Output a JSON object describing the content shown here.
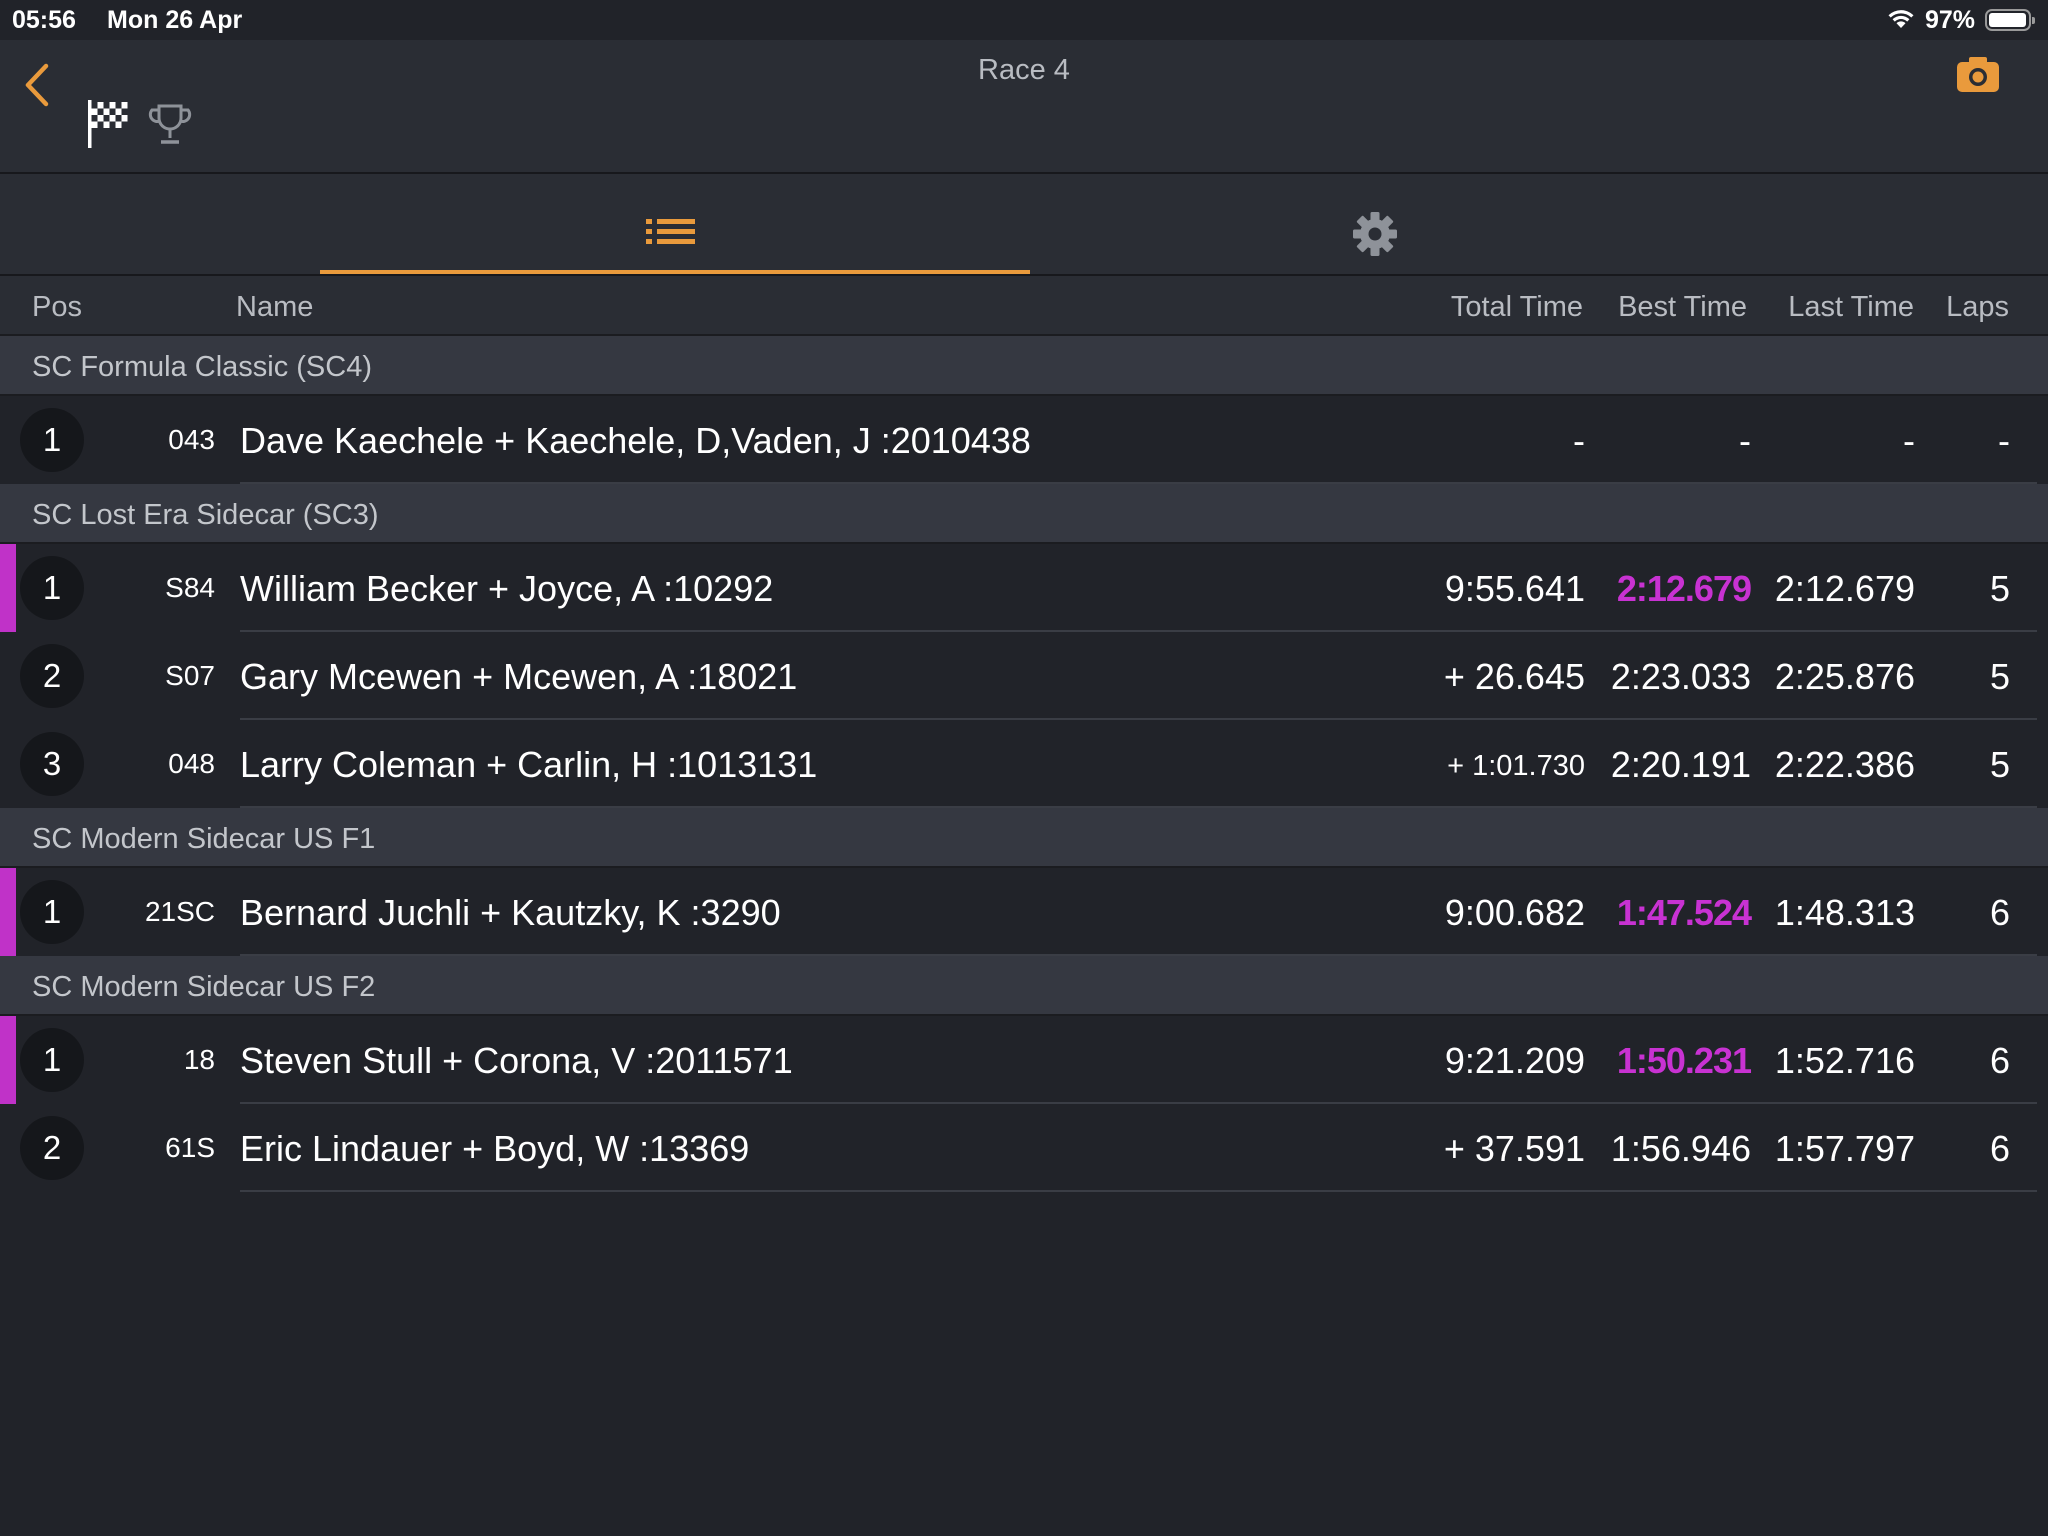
{
  "status_bar": {
    "time": "05:56",
    "date": "Mon 26 Apr",
    "battery_percent": "97%",
    "battery_level": 0.97
  },
  "nav": {
    "title": "Race 4",
    "icons": [
      "chevron-left-icon",
      "camera-icon",
      "checkered-flag-icon",
      "trophy-icon"
    ]
  },
  "tabs": [
    {
      "icon": "list-icon",
      "active": true
    },
    {
      "icon": "gear-icon",
      "active": false
    }
  ],
  "columns": {
    "pos": "Pos",
    "name": "Name",
    "total": "Total Time",
    "best": "Best Time",
    "last": "Last Time",
    "laps": "Laps"
  },
  "colors": {
    "accent": "#e99a3c",
    "best_highlight": "#c832d2",
    "background": "#212329"
  },
  "classes": [
    {
      "name": "SC Formula Classic (SC4)",
      "rows": [
        {
          "pos": "1",
          "num": "043",
          "name": "Dave Kaechele + Kaechele, D,Vaden, J :2010438",
          "total": "-",
          "best": "-",
          "last": "-",
          "laps": "-",
          "best_highlight": false
        }
      ]
    },
    {
      "name": "SC Lost Era Sidecar (SC3)",
      "rows": [
        {
          "pos": "1",
          "num": "S84",
          "name": "William Becker + Joyce, A :10292",
          "total": "9:55.641",
          "best": "2:12.679",
          "last": "2:12.679",
          "laps": "5",
          "best_highlight": true
        },
        {
          "pos": "2",
          "num": "S07",
          "name": "Gary Mcewen + Mcewen, A :18021",
          "total": "+ 26.645",
          "best": "2:23.033",
          "last": "2:25.876",
          "laps": "5",
          "best_highlight": false
        },
        {
          "pos": "3",
          "num": "048",
          "name": "Larry Coleman + Carlin, H :1013131",
          "total": "+ 1:01.730",
          "best": "2:20.191",
          "last": "2:22.386",
          "laps": "5",
          "best_highlight": false
        }
      ]
    },
    {
      "name": "SC Modern Sidecar US F1",
      "rows": [
        {
          "pos": "1",
          "num": "21SC",
          "name": "Bernard Juchli + Kautzky, K :3290",
          "total": "9:00.682",
          "best": "1:47.524",
          "last": "1:48.313",
          "laps": "6",
          "best_highlight": true
        }
      ]
    },
    {
      "name": "SC Modern Sidecar US F2",
      "rows": [
        {
          "pos": "1",
          "num": "18",
          "name": "Steven Stull + Corona, V :2011571",
          "total": "9:21.209",
          "best": "1:50.231",
          "last": "1:52.716",
          "laps": "6",
          "best_highlight": true
        },
        {
          "pos": "2",
          "num": "61S",
          "name": "Eric Lindauer + Boyd, W :13369",
          "total": "+ 37.591",
          "best": "1:56.946",
          "last": "1:57.797",
          "laps": "6",
          "best_highlight": false
        }
      ]
    }
  ]
}
